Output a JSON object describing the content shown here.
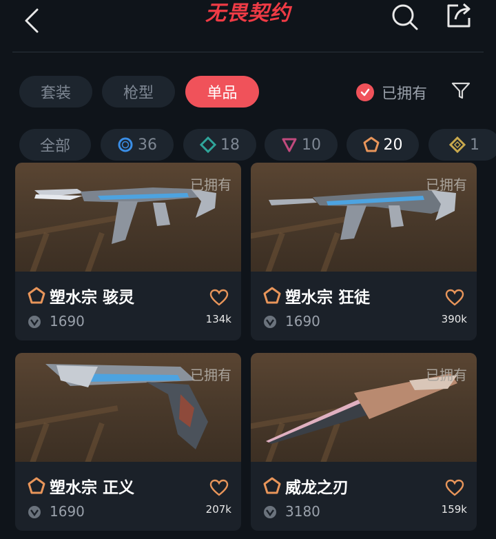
{
  "header": {
    "title": "无畏契约"
  },
  "tabs": [
    {
      "label": "套装",
      "active": false
    },
    {
      "label": "枪型",
      "active": false
    },
    {
      "label": "单品",
      "active": true
    }
  ],
  "owned_filter": {
    "label": "已拥有",
    "checked": true
  },
  "categories": [
    {
      "label": "全部",
      "icon": "none",
      "active": false
    },
    {
      "label": "36",
      "icon": "blue-circle-tier-icon",
      "active": false
    },
    {
      "label": "18",
      "icon": "green-diamond-tier-icon",
      "active": false
    },
    {
      "label": "10",
      "icon": "pink-triangle-tier-icon",
      "active": false
    },
    {
      "label": "20",
      "icon": "orange-pentagon-tier-icon",
      "active": true
    },
    {
      "label": "1",
      "icon": "gold-diamond-tier-icon",
      "active": false
    }
  ],
  "items": [
    {
      "name": "塑水宗 骇灵",
      "price": "1690",
      "likes": "134k",
      "owned_label": "已拥有",
      "weapon": "rifle-skin"
    },
    {
      "name": "塑水宗 狂徒",
      "price": "1690",
      "likes": "390k",
      "owned_label": "已拥有",
      "weapon": "rifle-skin"
    },
    {
      "name": "塑水宗 正义",
      "price": "1690",
      "likes": "207k",
      "owned_label": "已拥有",
      "weapon": "pistol-skin"
    },
    {
      "name": "威龙之刃",
      "price": "3180",
      "likes": "159k",
      "owned_label": "已拥有",
      "weapon": "knife-skin"
    }
  ],
  "colors": {
    "accent": "#f0525a",
    "background": "#0f141a",
    "card": "#1b2129",
    "tier": "#e8955a"
  }
}
